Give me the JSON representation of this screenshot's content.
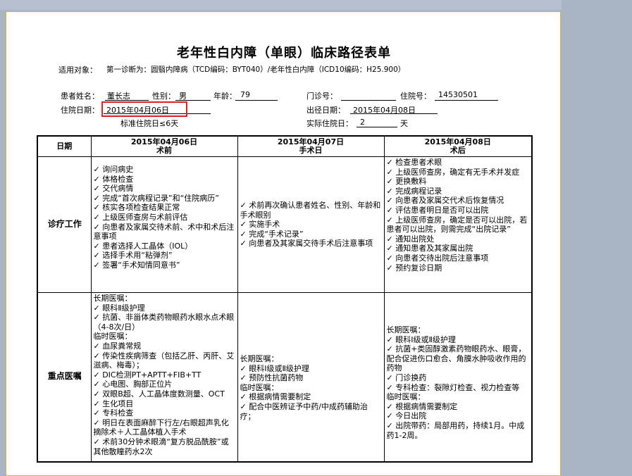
{
  "title": "老年性白内障（单眼）临床路径表单",
  "scope": {
    "label": "适用对象：",
    "text": "第一诊断为：圆翳内障病（TCD编码：BYT040）/老年性白内障（ICD10编码：H25.900）"
  },
  "patient": {
    "name_label": "患者姓名：",
    "name": "董长志",
    "sex_label": "性别：",
    "sex": "男",
    "age_label": "年龄：",
    "age": "79",
    "clinic_label": "门诊号：",
    "clinic_no": "",
    "inpatient_label": "住院号：",
    "inpatient_no": "14530501",
    "admit_label": "住院日期：",
    "admit_date": "2015年04月06日",
    "discharge_label": "出径日期：",
    "discharge_date": "2015年04月08日",
    "std_days": "标准住院日≤6天",
    "actual_label": "实际住院日：",
    "actual_days": "2",
    "actual_unit": "天"
  },
  "table": {
    "col0": "日期",
    "columns": [
      {
        "date": "2015年04月06日",
        "phase": "术前"
      },
      {
        "date": "2015年04月07日",
        "phase": "手术日"
      },
      {
        "date": "2015年04月08日",
        "phase": "术后"
      }
    ],
    "rows": [
      {
        "label": "诊疗工作",
        "cells": [
          [
            "✓ 询问病史",
            "✓ 体格检查",
            "✓ 交代病情",
            "✓ 完成“首次病程记录”和“住院病历”",
            "✓ 核实各项检查结果正常",
            "✓ 上级医师查房与术前评估",
            "✓ 向患者及家属交待术前、术中和术后注意事项",
            "✓ 患者选择人工晶体（IOL）",
            "✓ 选择手术用“粘弹剂”",
            "✓ 签署“手术知情同意书”"
          ],
          [
            "✓ 术前再次确认患者姓名、性别、年龄和手术眼别",
            "✓ 实施手术",
            "✓ 完成“手术记录”",
            "✓ 向患者及其家属交待手术后注意事项"
          ],
          [
            "✓ 检查患者术眼",
            "✓ 上级医师查房，确定有无手术并发症",
            "✓ 更换敷料",
            "✓ 完成病程记录",
            "✓ 向患者及家属交代术后恢复情况",
            "✓ 评估患者明日是否可以出院",
            "✓ 上级医师查房，确定是否可以出院，若患者可以出院，则需完成“出院记录”",
            "✓ 通知出院处",
            "✓ 通知患者及其家属出院",
            "✓ 向患者交待出院后注意事项",
            "✓ 预约复诊日期"
          ]
        ]
      },
      {
        "label": "重点医嘱",
        "cells": [
          [
            "长期医嘱：",
            "✓ 眼科Ⅱ级护理",
            "✓ 抗菌、非甾体类药物眼药水眼水点术眼（4-8次/日）",
            "临时医嘱：",
            "✓ 血尿粪常规",
            "✓ 传染性疾病筛查（包括乙肝、丙肝、艾滋病、梅毒）；",
            "✓ DIC检测PT+APTT+FIB+TT",
            "✓ 心电图、胸部正位片",
            "✓ 双眼B超、人工晶体度数测量、OCT",
            "✓ 生化项目",
            "✓ 专科检查",
            "✓ 明日在表面麻醉下行左/右眼超声乳化摘除术＋人工晶体植入手术",
            "✓ 术前30分钟术眼滴“复方脱品酰胺”或其他散瞳药水2次"
          ],
          [
            "长期医嘱：",
            "✓ 眼科Ⅰ级或Ⅱ级护理",
            "✓ 预防性抗菌药物",
            "临时医嘱：",
            "✓ 根据病情需要制定",
            "✓ 配合中医辨证予中药/中成药辅助治疗；"
          ],
          [
            "长期医嘱：",
            "✓ 眼科Ⅰ级或Ⅱ级护理",
            "✓ 抗菌+类固醇激素药物眼药水、眼膏，配合促进伤口愈合、角膜水肿吸收作用的药物",
            "✓ 门诊换药",
            "✓ 专科检查：裂隙灯检查、视力检查等",
            "临时医嘱：",
            "✓ 根据病情需要制定",
            "✓ 今日出院",
            "✓ 出院带药：局部用药，持续1月。中成药1-2周。"
          ]
        ]
      }
    ]
  }
}
